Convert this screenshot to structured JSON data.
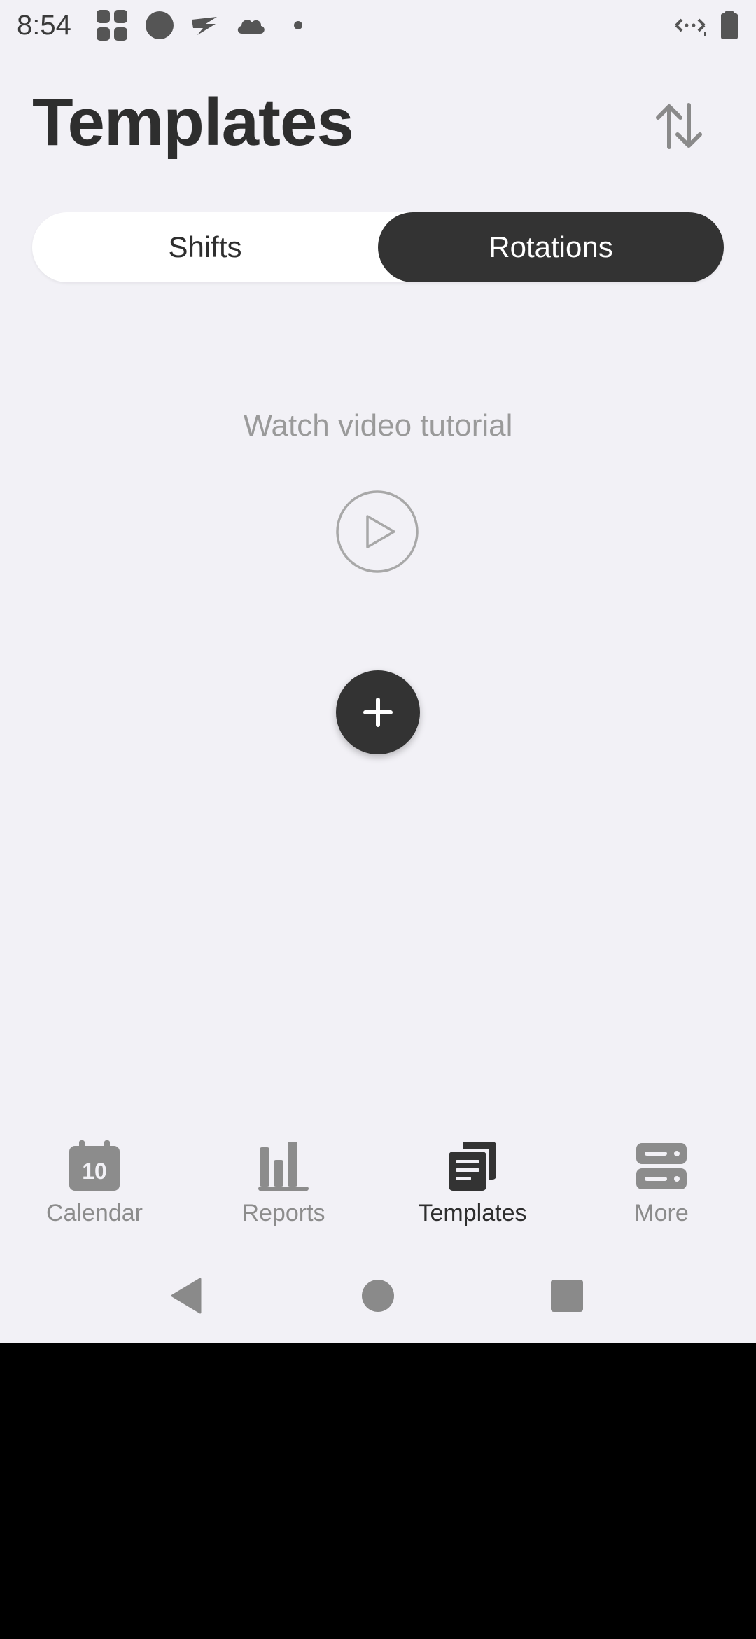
{
  "status_bar": {
    "time": "8:54"
  },
  "header": {
    "title": "Templates",
    "sort_icon": "sort-up-down-icon"
  },
  "segmented": {
    "options": [
      {
        "label": "Shifts",
        "selected": false
      },
      {
        "label": "Rotations",
        "selected": true
      }
    ]
  },
  "tutorial": {
    "text": "Watch video tutorial",
    "icon": "play-icon"
  },
  "add_button": {
    "icon": "plus-icon"
  },
  "bottom_nav": {
    "items": [
      {
        "label": "Calendar",
        "icon": "calendar-icon",
        "icon_text": "10",
        "active": false
      },
      {
        "label": "Reports",
        "icon": "bar-chart-icon",
        "active": false
      },
      {
        "label": "Templates",
        "icon": "templates-icon",
        "active": true
      },
      {
        "label": "More",
        "icon": "more-icon",
        "active": false
      }
    ]
  },
  "colors": {
    "background": "#f2f1f6",
    "accent_dark": "#333333",
    "text_dark": "#2e2e2e",
    "text_muted": "#8c8c8c"
  }
}
